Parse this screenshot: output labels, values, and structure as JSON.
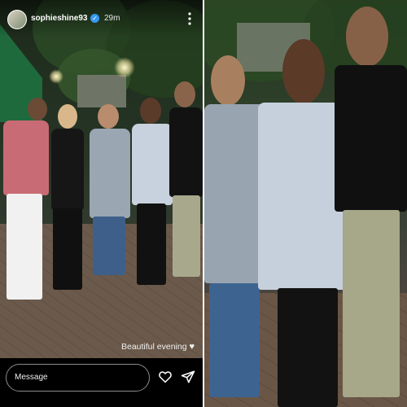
{
  "story": {
    "username": "sophieshine93",
    "time": "29m",
    "caption": "Beautiful evening",
    "caption_icon": "white-heart",
    "reply_placeholder": "Message"
  },
  "icons": {
    "verified": "verified-badge-icon",
    "more": "more-options-icon",
    "like": "heart-outline-icon",
    "share": "send-icon"
  },
  "colors": {
    "verified_blue": "#3897f0",
    "background": "#000000",
    "text": "#ffffff"
  }
}
